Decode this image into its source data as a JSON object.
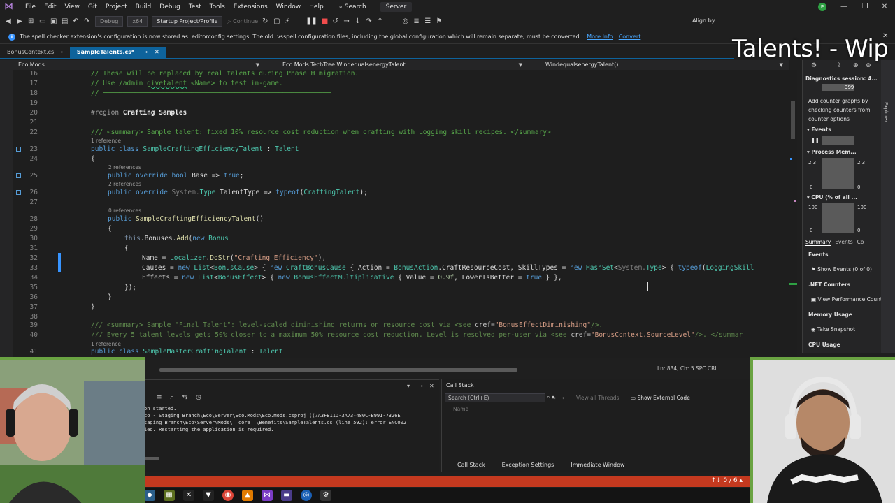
{
  "menubar": {
    "items": [
      "File",
      "Edit",
      "View",
      "Git",
      "Project",
      "Build",
      "Debug",
      "Test",
      "Tools",
      "Extensions",
      "Window",
      "Help"
    ],
    "search_label": "Search",
    "server_label": "Server",
    "avatar_initial": "P"
  },
  "toolbar": {
    "config": "Debug",
    "platform": "x64",
    "startup": "Startup Project/Profile",
    "continue_label": "Continue",
    "align_label": "Align by..."
  },
  "infobar": {
    "message": "The spell checker extension's configuration is now stored as .editorconfig settings. The old .vsspell configuration files, including the global configuration which will remain separate, must be converted.",
    "more_info": "More Info",
    "convert": "Convert"
  },
  "tabs": [
    {
      "label": "BonusContext.cs",
      "active": false
    },
    {
      "label": "SampleTalents.cs*",
      "active": true
    }
  ],
  "navbar": {
    "project": "Eco.Mods",
    "type": "Eco.Mods.TechTree.WindequalsenergyTalent",
    "member": "WindequalsenergyTalent()"
  },
  "editor": {
    "ref_1": "1 reference",
    "ref_2": "2 references",
    "ref_0": "0 references",
    "status": "Ln: 834, Ch: 5   SPC   CRL"
  },
  "overlay_title": "Talents! - Wip",
  "diagnostics": {
    "header": "Diagnostics session: 4...",
    "top_value": "399",
    "tip": "Add counter graphs by checking counters from counter options",
    "events": "Events",
    "process_memory": "Process Mem...",
    "mem_left": "2.3",
    "mem_right": "2.3",
    "mem_zero": "0",
    "cpu": "CPU (% of all ...",
    "cpu_max": "100",
    "cpu_zero": "0",
    "subtabs": [
      "Summary",
      "Events",
      "Co"
    ],
    "events_title": "Events",
    "show_events": "Show Events (0 of 0)",
    "net_counters": ".NET Counters",
    "view_perf": "View Performance Count",
    "memory_usage": "Memory Usage",
    "take_snapshot": "Take Snapshot",
    "cpu_usage": "CPU Usage",
    "side_label": "Explorer"
  },
  "output": {
    "lines": [
      "on started.",
      "co - Staging Branch\\Eco\\Server\\Eco.Mods\\Eco.Mods.csproj ((7A3FB11D-3A73-480C-B991-7326E",
      "taging Branch\\Eco\\Server\\Mods\\__core__\\Benefits\\SampleTalents.cs (line 592): error ENC002",
      "ied. Restarting the application is required."
    ]
  },
  "callstack": {
    "title": "Call Stack",
    "search_placeholder": "Search (Ctrl+E)",
    "view_all_threads": "View all Threads",
    "show_external": "Show External Code",
    "col_name": "Name",
    "bottom_tabs": [
      "Call Stack",
      "Exception Settings",
      "Immediate Window"
    ]
  },
  "statusbar": {
    "text": "↑↓ 0 / 6 ▴"
  }
}
